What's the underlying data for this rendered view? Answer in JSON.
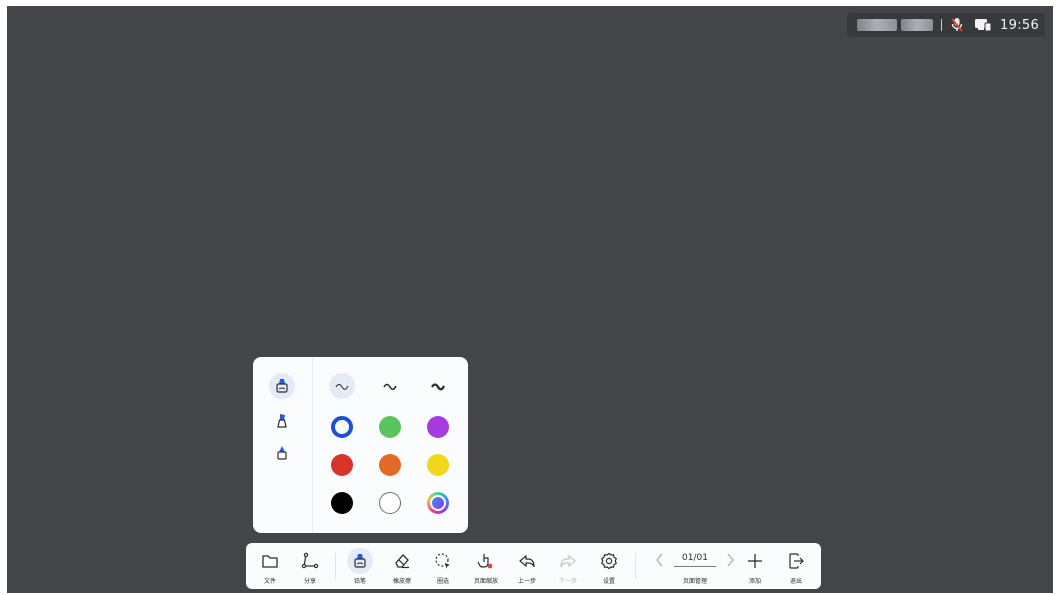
{
  "status_bar": {
    "time": "19:56",
    "icons": [
      "mic-muted-icon",
      "screen-cast-icon"
    ],
    "accent_red": "#e0453a"
  },
  "pen_popup": {
    "pen_types": [
      "pen-highlight-icon",
      "pen-marker-icon",
      "pen-fountain-icon"
    ],
    "selected_pen": 0,
    "stroke_widths": [
      "stroke-thin-icon",
      "stroke-medium-icon",
      "stroke-thick-icon"
    ],
    "selected_stroke": 0,
    "colors": [
      "#1f4fd6",
      "#5cc45e",
      "#a83be0",
      "#d9342b",
      "#e36a26",
      "#f2d61a",
      "#000000",
      "#ffffff",
      "rainbow"
    ],
    "selected_color": 0
  },
  "toolbar": {
    "file": "文件",
    "share": "分享",
    "pen": "铅笔",
    "eraser": "橡皮擦",
    "lasso": "圈选",
    "zoom": "页面缩放",
    "undo": "上一步",
    "redo": "下一步",
    "settings": "设置",
    "page_number": "01/01",
    "page_manage": "页面管理",
    "add": "添加",
    "exit": "退出"
  }
}
